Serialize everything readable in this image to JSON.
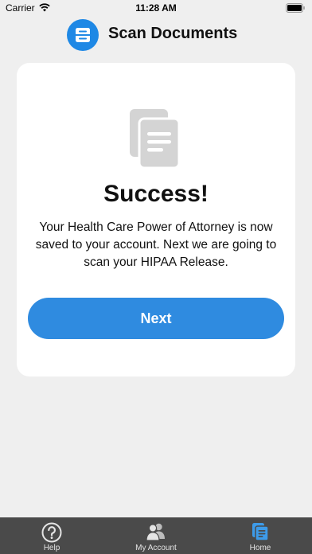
{
  "status_bar": {
    "carrier": "Carrier",
    "time": "11:28 AM"
  },
  "header": {
    "title": "Scan Documents",
    "logo_color": "#1e88e5"
  },
  "card": {
    "icon": "documents-icon",
    "title": "Success!",
    "message": "Your Health Care Power of Attorney is now saved to your account. Next we are going to scan your HIPAA Release.",
    "next_label": "Next",
    "button_color": "#2f8be0"
  },
  "tabs": [
    {
      "label": "Help",
      "icon": "help-icon",
      "active": false
    },
    {
      "label": "My Account",
      "icon": "account-icon",
      "active": false
    },
    {
      "label": "Home",
      "icon": "home-documents-icon",
      "active": true
    }
  ],
  "colors": {
    "tab_bar": "#4a4a4a",
    "active_tab_icon": "#3d9be9",
    "background": "#efefef"
  }
}
